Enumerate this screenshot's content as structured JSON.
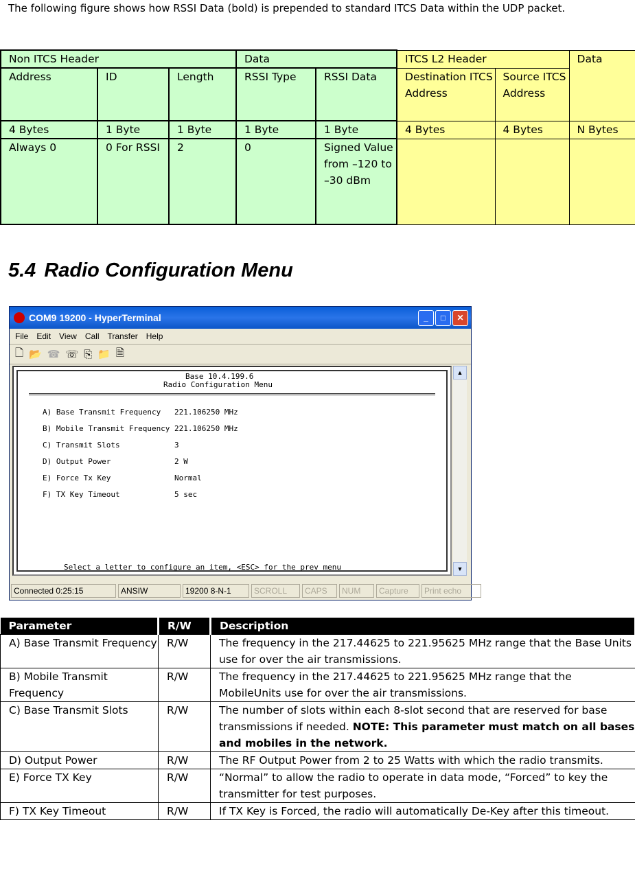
{
  "intro": "The following figure shows how RSSI Data (bold) is prepended to standard ITCS Data within the UDP packet.",
  "t1": {
    "groups": [
      "Non ITCS Header",
      "Data",
      "ITCS L2 Header",
      "Data"
    ],
    "headers": [
      "Address",
      "ID",
      "Length",
      "RSSI Type",
      "RSSI Data",
      "Destination ITCS Address",
      "Source ITCS Address"
    ],
    "sizes": [
      "4 Bytes",
      "1 Byte",
      "1 Byte",
      "1 Byte",
      "1 Byte",
      "4 Bytes",
      "4 Bytes",
      "N Bytes"
    ],
    "values": [
      "Always 0",
      "0 For RSSI",
      "2",
      "0",
      "Signed Value from –120 to –30 dBm",
      "",
      "",
      ""
    ]
  },
  "section": {
    "number": "5.4",
    "title": "Radio Configuration Menu"
  },
  "window": {
    "title": "COM9 19200 - HyperTerminal",
    "menu": [
      "File",
      "Edit",
      "View",
      "Call",
      "Transfer",
      "Help"
    ],
    "terminal": {
      "line1": "Base 10.4.199.6",
      "line2": "Radio Configuration Menu",
      "items": [
        "A) Base Transmit Frequency   221.106250 MHz",
        "B) Mobile Transmit Frequency 221.106250 MHz",
        "C) Transmit Slots            3",
        "D) Output Power              2 W",
        "E) Force Tx Key              Normal",
        "F) TX Key Timeout            5 sec"
      ],
      "prompt": "Select a letter to configure an item, <ESC> for the prev menu"
    },
    "status": [
      "Connected 0:25:15",
      "ANSIW",
      "19200 8-N-1",
      "SCROLL",
      "CAPS",
      "NUM",
      "Capture",
      "Print echo"
    ]
  },
  "t2": {
    "headers": [
      "Parameter",
      "R/W",
      "Description"
    ],
    "rows": [
      {
        "p": "A) Base Transmit Frequency",
        "rw": "R/W",
        "d": "The frequency in the 217.44625 to 221.95625 MHz range that the Base Units use for over the air transmissions.",
        "b": ""
      },
      {
        "p": "B) Mobile  Transmit Frequency",
        "rw": "R/W",
        "d": "The frequency in the 217.44625 to 221.95625 MHz range that the MobileUnits use for over the air transmissions.",
        "b": ""
      },
      {
        "p": "C) Base Transmit Slots",
        "rw": "R/W",
        "d": "The number of slots within each 8-slot second that are reserved for base transmissions if needed.  ",
        "b": "NOTE: This parameter must match on all bases and mobiles in the network."
      },
      {
        "p": "D) Output Power",
        "rw": "R/W",
        "d": "The RF Output Power from 2 to 25 Watts with which the radio transmits.",
        "b": ""
      },
      {
        "p": "E) Force TX Key",
        "rw": "R/W",
        "d": "“Normal” to allow the radio to operate in data mode, “Forced” to key the transmitter for test purposes.",
        "b": ""
      },
      {
        "p": "F) TX Key Timeout",
        "rw": "R/W",
        "d": "If TX Key is Forced, the radio will automatically De-Key after this timeout.",
        "b": ""
      }
    ]
  }
}
